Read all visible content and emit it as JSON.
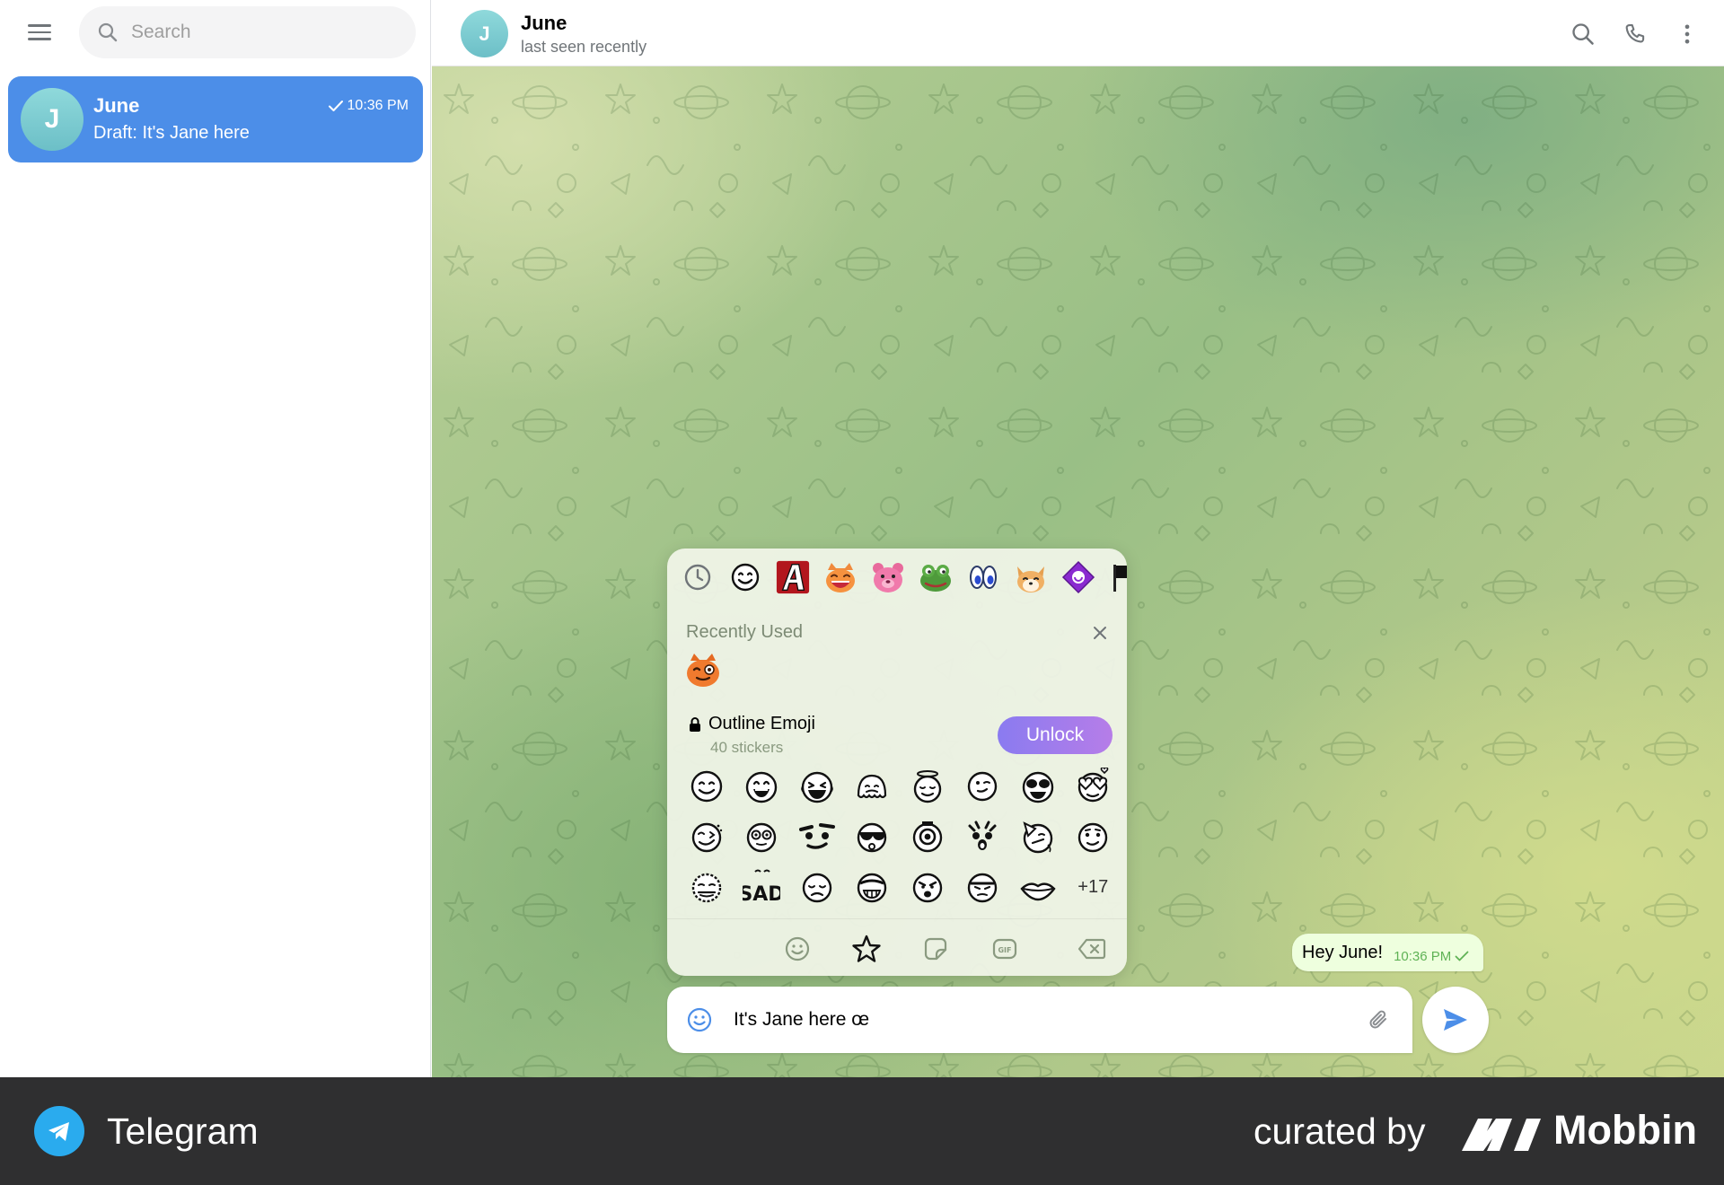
{
  "sidebar": {
    "search_placeholder": "Search",
    "chats": [
      {
        "avatar_letter": "J",
        "name": "June",
        "time": "10:36 PM",
        "preview": "Draft: It's Jane here"
      }
    ]
  },
  "header": {
    "avatar_letter": "J",
    "title": "June",
    "status": "last seen recently"
  },
  "emoji_panel": {
    "set_tabs": [
      "clock-icon",
      "smile-outline-icon",
      "letter-a-sticker-icon",
      "laughing-cat-icon",
      "pink-bear-icon",
      "frog-icon",
      "eyes-icon",
      "shiba-icon",
      "purple-diamond-icon",
      "flag-icon"
    ],
    "recent_title": "Recently Used",
    "recent_emojis": [
      "orange-cat-wink-icon"
    ],
    "set_name": "Outline Emoji",
    "set_count": "40 stickers",
    "unlock_label": "Unlock",
    "more_count": "+17",
    "footer_tabs": [
      "emoji-tab-icon",
      "favorites-star-icon",
      "sticker-tab-icon",
      "gif-tab-icon",
      "backspace-icon"
    ]
  },
  "messages": [
    {
      "text": "Hey June!",
      "time": "10:36 PM",
      "status": "sent"
    }
  ],
  "composer": {
    "value": "It's Jane here œ"
  },
  "brand": {
    "app_name": "Telegram",
    "curated_by": "curated by",
    "mobbin": "Mobbin"
  },
  "colors": {
    "accent": "#4c8ee8",
    "bubble": "#eeffde",
    "unlock_gradient_start": "#8a7bf0",
    "unlock_gradient_end": "#b67de8",
    "brand_bar": "#2f2f30"
  }
}
